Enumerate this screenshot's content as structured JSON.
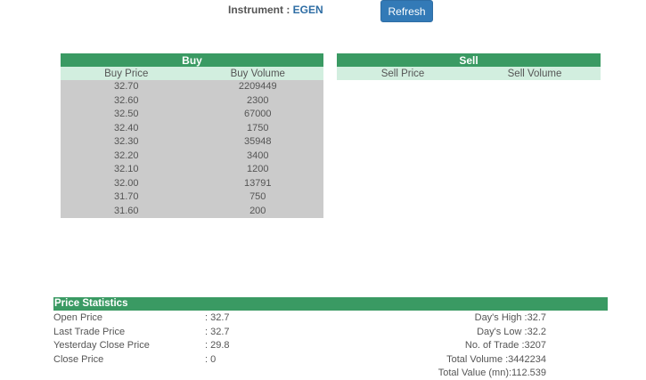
{
  "instrument": {
    "label": "Instrument : ",
    "code": "EGEN"
  },
  "refresh_label": "Refresh",
  "buy": {
    "title": "Buy",
    "col_price": "Buy Price",
    "col_volume": "Buy Volume",
    "rows": [
      {
        "price": "32.70",
        "volume": "2209449"
      },
      {
        "price": "32.60",
        "volume": "2300"
      },
      {
        "price": "32.50",
        "volume": "67000"
      },
      {
        "price": "32.40",
        "volume": "1750"
      },
      {
        "price": "32.30",
        "volume": "35948"
      },
      {
        "price": "32.20",
        "volume": "3400"
      },
      {
        "price": "32.10",
        "volume": "1200"
      },
      {
        "price": "32.00",
        "volume": "13791"
      },
      {
        "price": "31.70",
        "volume": "750"
      },
      {
        "price": "31.60",
        "volume": "200"
      }
    ]
  },
  "sell": {
    "title": "Sell",
    "col_price": "Sell Price",
    "col_volume": "Sell Volume",
    "rows": []
  },
  "stats": {
    "title": "Price Statistics",
    "left": [
      {
        "label": "Open Price",
        "value": ": 32.7"
      },
      {
        "label": "Last Trade Price",
        "value": ": 32.7"
      },
      {
        "label": "Yesterday Close Price",
        "value": ": 29.8"
      },
      {
        "label": "Close Price",
        "value": ": 0"
      }
    ],
    "right": [
      "Day's High :32.7",
      "Day's Low :32.2",
      "No. of Trade :3207",
      "Total Volume :3442234",
      "Total Value (mn):112.539"
    ]
  },
  "colors": {
    "header_green": "#3a9a63",
    "subheader_mint": "#d2eedf",
    "buy_row_gray": "#cbcbcb",
    "button_blue": "#337ab7",
    "instrument_code_blue": "#2e6da4"
  }
}
